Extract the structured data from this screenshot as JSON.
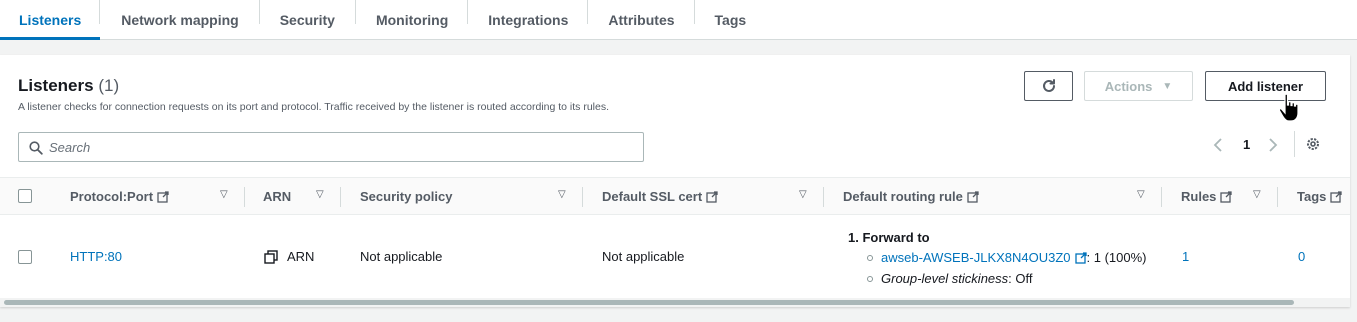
{
  "tabs": [
    {
      "label": "Listeners",
      "active": true
    },
    {
      "label": "Network mapping"
    },
    {
      "label": "Security"
    },
    {
      "label": "Monitoring"
    },
    {
      "label": "Integrations"
    },
    {
      "label": "Attributes"
    },
    {
      "label": "Tags"
    }
  ],
  "panel": {
    "title": "Listeners",
    "count": "(1)",
    "description": "A listener checks for connection requests on its port and protocol. Traffic received by the listener is routed according to its rules.",
    "actions_label": "Actions",
    "add_listener_label": "Add listener",
    "search_placeholder": "Search",
    "page_number": "1"
  },
  "table": {
    "headers": {
      "protocol_port": "Protocol:Port",
      "arn": "ARN",
      "security_policy": "Security policy",
      "default_ssl_cert": "Default SSL cert",
      "default_routing_rule": "Default routing rule",
      "rules": "Rules",
      "tags": "Tags"
    },
    "rows": [
      {
        "protocol_port": "HTTP:80",
        "arn": "ARN",
        "security_policy": "Not applicable",
        "default_ssl_cert": "Not applicable",
        "routing_line1": "1. Forward to",
        "routing_target": "awseb-AWSEB-JLKX8N4OU3Z0",
        "routing_weight": ": 1 (100%)",
        "routing_stickiness_label": "Group-level stickiness",
        "routing_stickiness_value": ": Off",
        "rules": "1",
        "tags": "0"
      }
    ]
  },
  "colors": {
    "accent": "#0073bb",
    "text": "#16191f",
    "muted": "#545b64",
    "background": "#f2f3f3"
  }
}
